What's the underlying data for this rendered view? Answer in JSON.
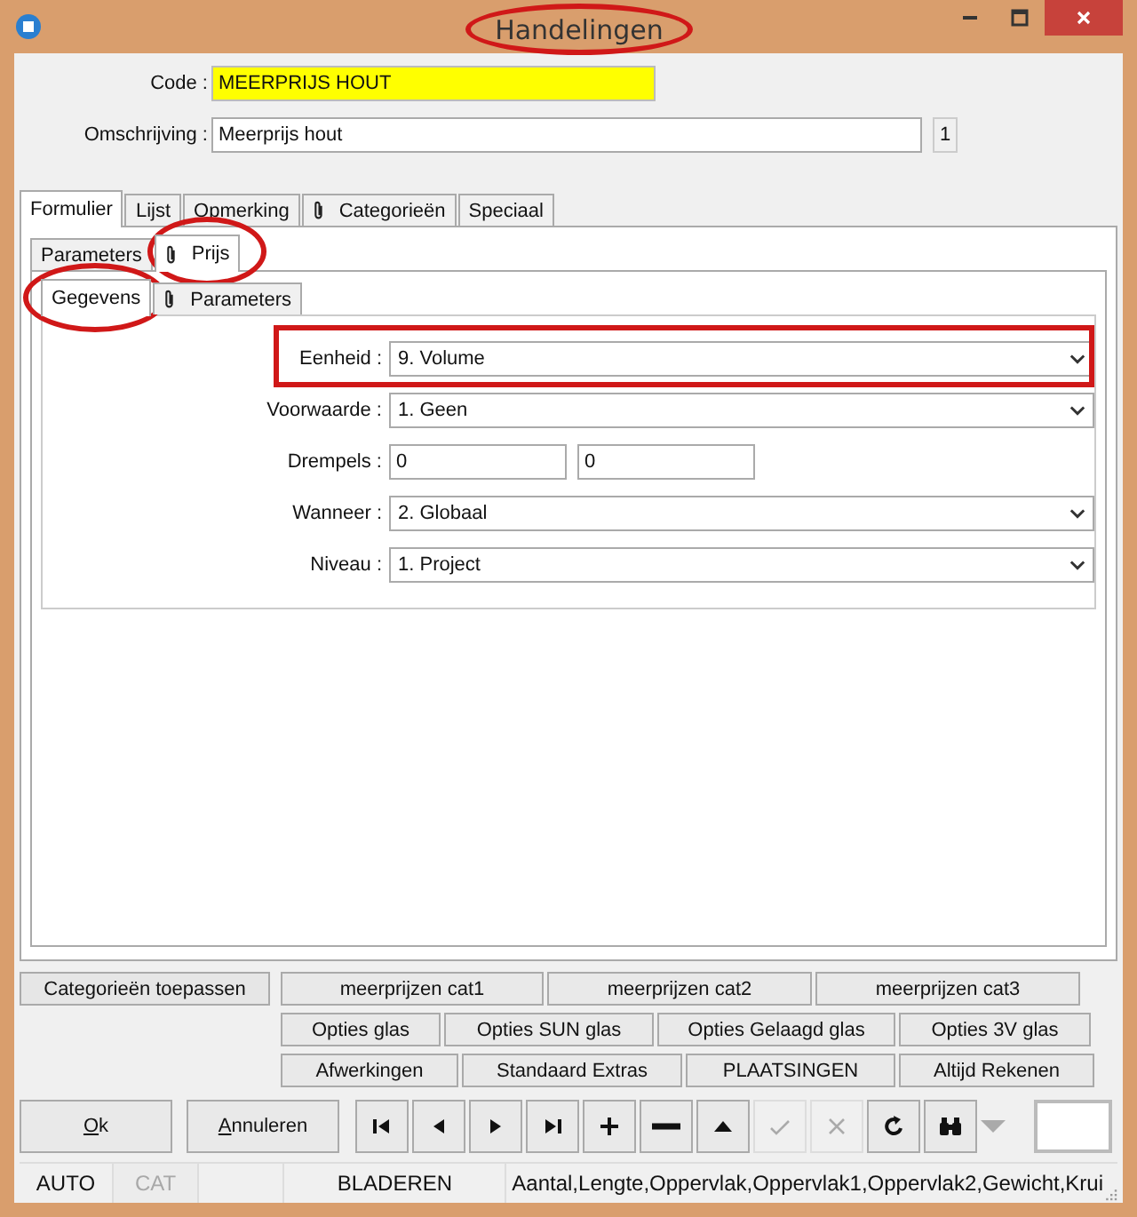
{
  "window": {
    "title": "Handelingen",
    "highlighted": true
  },
  "code": {
    "label": "Code :",
    "value": "MEERPRIJS HOUT"
  },
  "omschrijving": {
    "label": "Omschrijving :",
    "value": "Meerprijs hout",
    "counter": "1"
  },
  "tabs": [
    {
      "label": "Formulier",
      "selected": true,
      "clip": false
    },
    {
      "label": "Lijst",
      "selected": false,
      "clip": false
    },
    {
      "label": "Opmerking",
      "selected": false,
      "clip": false
    },
    {
      "label": "Categorieën",
      "selected": false,
      "clip": true
    },
    {
      "label": "Speciaal",
      "selected": false,
      "clip": false
    }
  ],
  "subtabs": [
    {
      "label": "Parameters",
      "selected": false,
      "clip": false,
      "highlighted": false
    },
    {
      "label": "Prijs",
      "selected": true,
      "clip": true,
      "highlighted": true
    }
  ],
  "price_tabs": [
    {
      "label": "Gegevens",
      "selected": true,
      "clip": false,
      "highlighted": true
    },
    {
      "label": "Parameters",
      "selected": false,
      "clip": true,
      "highlighted": false
    }
  ],
  "fields": [
    {
      "label": "Eenheid :",
      "kind": "dropdown",
      "value": "9.  Volume",
      "highlighted": true
    },
    {
      "label": "Voorwaarde :",
      "kind": "dropdown",
      "value": "1.  Geen",
      "highlighted": false
    },
    {
      "label": "Drempels :",
      "kind": "pair",
      "values": [
        "0",
        "0"
      ],
      "highlighted": false
    },
    {
      "label": "Wanneer :",
      "kind": "dropdown",
      "value": "2.  Globaal",
      "highlighted": false
    },
    {
      "label": "Niveau :",
      "kind": "dropdown",
      "value": "1.  Project",
      "highlighted": false
    }
  ],
  "category_button": "Categorieën toepassen",
  "button_rows": [
    [
      "meerprijzen cat1",
      "meerprijzen cat2",
      "meerprijzen cat3"
    ],
    [
      "Opties glas",
      "Opties SUN glas",
      "Opties Gelaagd glas",
      "Opties 3V glas"
    ],
    [
      "Afwerkingen",
      "Standaard Extras",
      "PLAATSINGEN",
      "Altijd Rekenen"
    ]
  ],
  "actions": [
    {
      "label": "Ok"
    },
    {
      "label": "Annuleren"
    }
  ],
  "nav_buttons": [
    {
      "kind": "first",
      "disabled": false
    },
    {
      "kind": "prev",
      "disabled": false
    },
    {
      "kind": "next",
      "disabled": false
    },
    {
      "kind": "last",
      "disabled": false
    },
    {
      "kind": "add",
      "disabled": false
    },
    {
      "kind": "remove",
      "disabled": false
    },
    {
      "kind": "up",
      "disabled": false
    },
    {
      "kind": "confirm",
      "disabled": true
    },
    {
      "kind": "cancel",
      "disabled": true
    },
    {
      "kind": "refresh",
      "disabled": false
    },
    {
      "kind": "find",
      "disabled": false
    },
    {
      "kind": "caret",
      "disabled": true
    }
  ],
  "status_bar": [
    {
      "kind": "panel",
      "text": "AUTO",
      "disabled": false
    },
    {
      "kind": "panel",
      "text": "CAT",
      "disabled": true
    },
    {
      "kind": "spacer"
    },
    {
      "kind": "panel",
      "text": "BLADEREN",
      "disabled": false
    },
    {
      "kind": "panel",
      "text": "Aantal,Lengte,Oppervlak,Oppervlak1,Oppervlak2,Gewicht,Krui",
      "disabled": false
    }
  ]
}
